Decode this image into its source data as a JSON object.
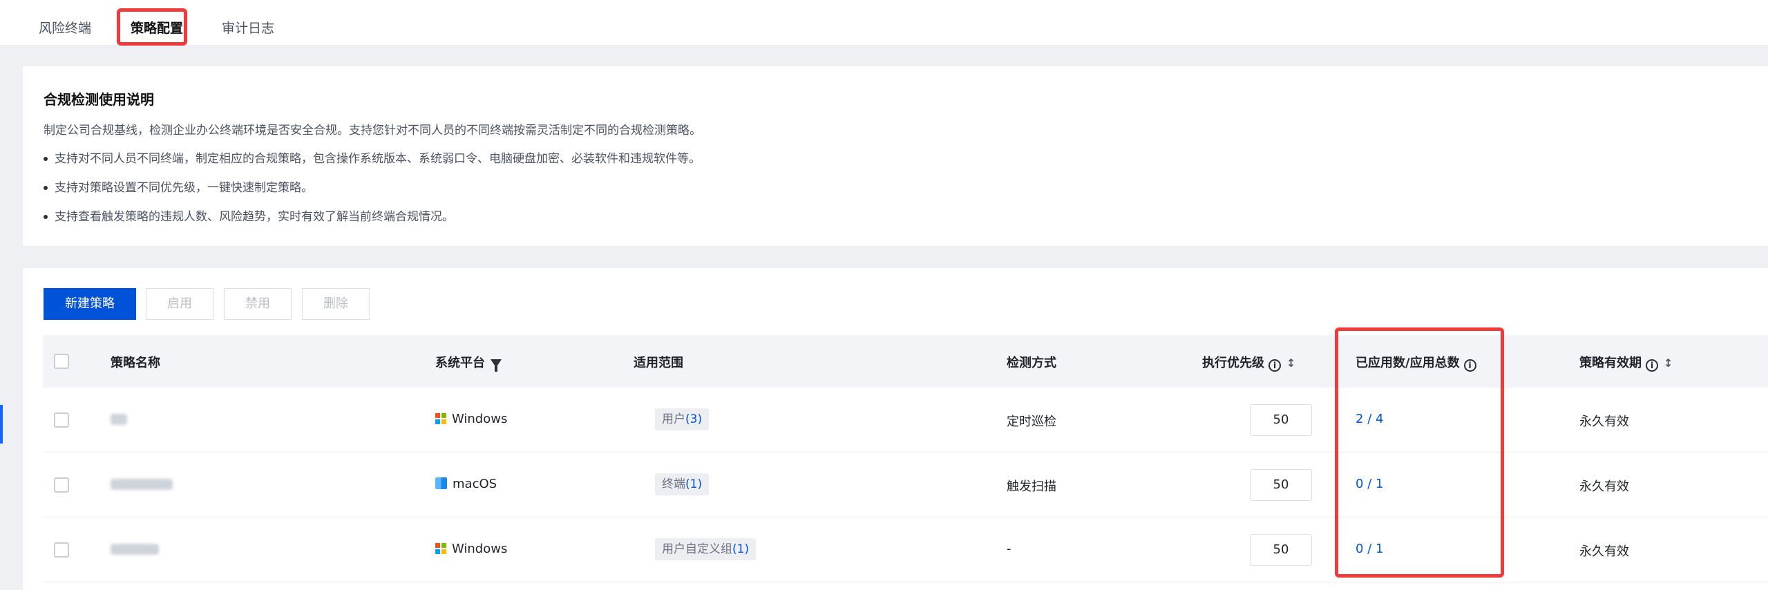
{
  "tabs": [
    {
      "label": "风险终端",
      "active": false
    },
    {
      "label": "策略配置",
      "active": true
    },
    {
      "label": "审计日志",
      "active": false
    }
  ],
  "info": {
    "title": "合规检测使用说明",
    "desc": "制定公司合规基线，检测企业办公终端环境是否安全合规。支持您针对不同人员的不同终端按需灵活制定不同的合规检测策略。",
    "bullets": [
      "支持对不同人员不同终端，制定相应的合规策略，包含操作系统版本、系统弱口令、电脑硬盘加密、必装软件和违规软件等。",
      "支持对策略设置不同优先级，一键快速制定策略。",
      "支持查看触发策略的违规人数、风险趋势，实时有效了解当前终端合规情况。"
    ]
  },
  "toolbar": {
    "new_label": "新建策略",
    "enable_label": "启用",
    "disable_label": "禁用",
    "delete_label": "删除"
  },
  "table": {
    "headers": {
      "name": "策略名称",
      "platform": "系统平台",
      "scope": "适用范围",
      "method": "检测方式",
      "priority": "执行优先级",
      "applied": "已应用数/应用总数",
      "validity": "策略有效期"
    },
    "rows": [
      {
        "platform": "Windows",
        "platform_icon": "windows-icon",
        "scope_label": "用户",
        "scope_count": "(3)",
        "method": "定时巡检",
        "priority": "50",
        "applied": "2",
        "total": "4",
        "validity": "永久有效"
      },
      {
        "platform": "macOS",
        "platform_icon": "macos-icon",
        "scope_label": "终端",
        "scope_count": "(1)",
        "method": "触发扫描",
        "priority": "50",
        "applied": "0",
        "total": "1",
        "validity": "永久有效"
      },
      {
        "platform": "Windows",
        "platform_icon": "windows-icon",
        "scope_label": "用户自定义组",
        "scope_count": "(1)",
        "method": "-",
        "priority": "50",
        "applied": "0",
        "total": "1",
        "validity": "永久有效"
      }
    ],
    "slash": "/"
  },
  "colors": {
    "primary": "#0052d9",
    "highlight": "#ef3b3b"
  }
}
